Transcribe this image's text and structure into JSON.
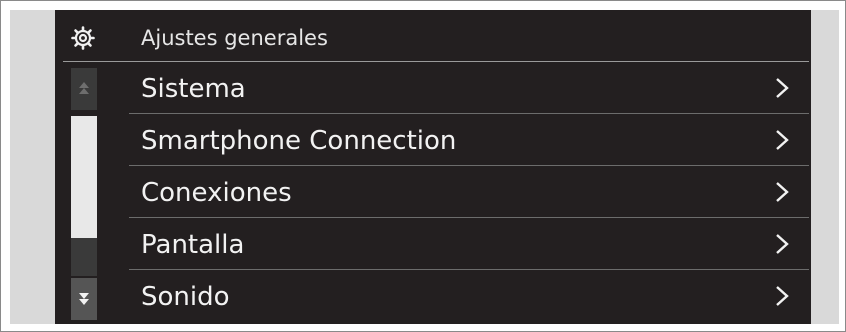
{
  "header": {
    "title": "Ajustes generales",
    "icon": "gear-icon"
  },
  "menu": {
    "items": [
      {
        "label": "Sistema",
        "icon": "chevron-right-icon"
      },
      {
        "label": "Smartphone Connection",
        "icon": "chevron-right-icon"
      },
      {
        "label": "Conexiones",
        "icon": "chevron-right-icon"
      },
      {
        "label": "Pantalla",
        "icon": "chevron-right-icon"
      },
      {
        "label": "Sonido",
        "icon": "chevron-right-icon"
      }
    ]
  },
  "scrollbar": {
    "up_icon": "scroll-up-icon",
    "down_icon": "scroll-down-icon"
  },
  "colors": {
    "screen_background": "#231f20",
    "text": "#f2f2f2",
    "divider": "#6c6c6c",
    "scroll_thumb": "#e8e8e8"
  }
}
